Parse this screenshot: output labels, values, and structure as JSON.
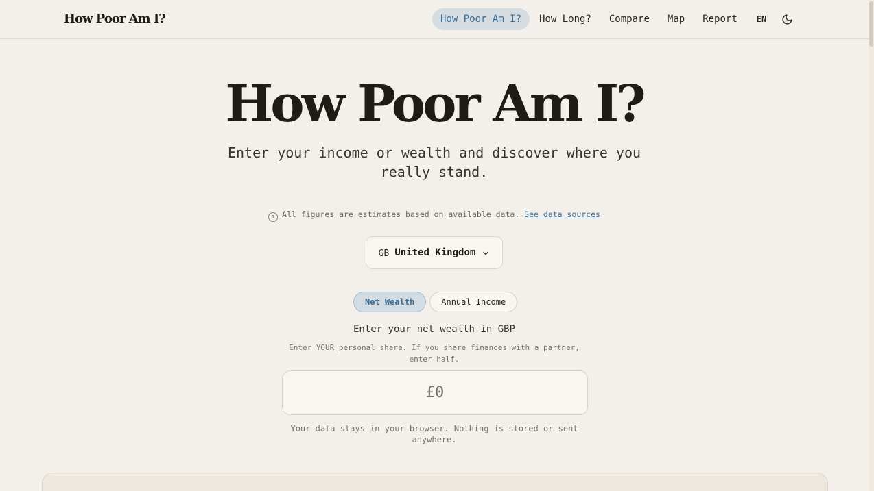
{
  "header": {
    "brand": "How Poor Am I?",
    "nav": [
      {
        "label": "How Poor Am I?",
        "active": true
      },
      {
        "label": "How Long?"
      },
      {
        "label": "Compare"
      },
      {
        "label": "Map"
      },
      {
        "label": "Report"
      }
    ],
    "language": "EN",
    "theme_icon": "moon-icon"
  },
  "hero": {
    "title": "How Poor Am I?",
    "subtitle": "Enter your income or wealth and discover where you really stand."
  },
  "disclaimer": {
    "icon": "info-icon",
    "text": "All figures are estimates based on available data.",
    "link": "See data sources"
  },
  "country": {
    "code": "GB",
    "name": "United Kingdom",
    "icon": "chevron-down-icon"
  },
  "mode": {
    "options": [
      "Net Wealth",
      "Annual Income"
    ],
    "selected": "Net Wealth"
  },
  "form": {
    "label": "Enter your net wealth in GBP",
    "hint": "Enter YOUR personal share. If you share finances with a partner, enter half.",
    "placeholder": "£0",
    "value": ""
  },
  "privacy": "Your data stays in your browser. Nothing is stored or sent anywhere.",
  "colors": {
    "background": "#f3efea",
    "accent": "#3d6f96",
    "active_pill": "#d5dde3"
  }
}
